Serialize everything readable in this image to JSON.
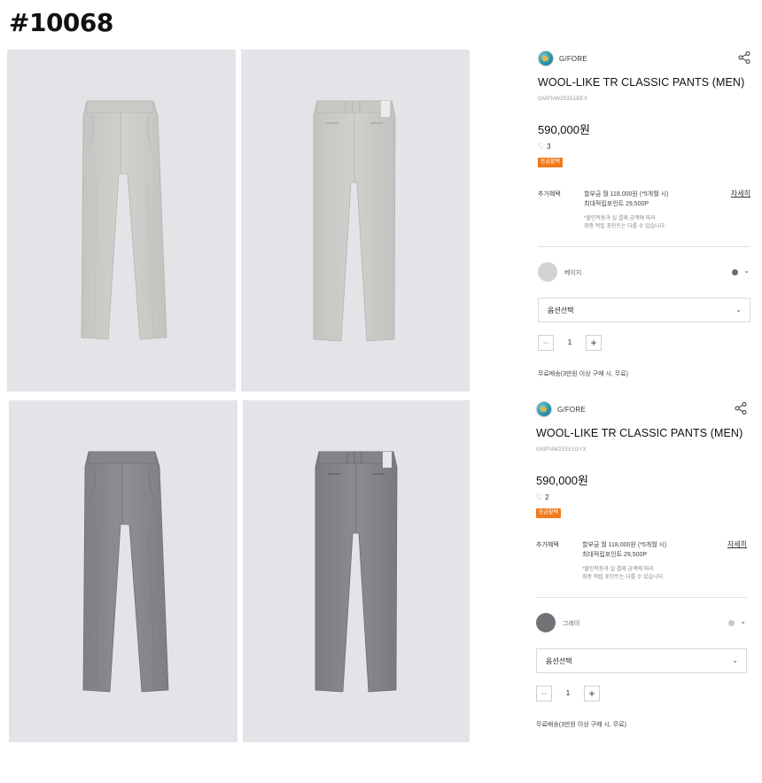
{
  "page_id": "#10068",
  "products": [
    {
      "brand": "G/FORE",
      "title": "WOOL-LIKE TR CLASSIC PANTS (MEN)",
      "code": "GMPNW25351BEX",
      "price": "590,000원",
      "likes": "3",
      "badge": "등급할택",
      "benefit_label": "추가혜택",
      "benefit_line1": "할부금 월 118,000원 (*5개월 시)",
      "benefit_line2": "최대적립포인트 29,500P",
      "benefit_note1": "*할인적용과 실 결제 금액에 따라",
      "benefit_note2": "최종 적립 포인트는 다를 수 있습니다.",
      "detail_link": "자세히",
      "color_name": "베이지",
      "swatch_color": "#d4d3d1",
      "dot_color": "#6b6b6b",
      "option_label": "옵션선택",
      "qty_minus": "−",
      "qty": "1",
      "qty_plus": "+",
      "shipping": "무료배송(3만원 이상 구매 시, 무료)"
    },
    {
      "brand": "G/FORE",
      "title": "WOOL-LIKE TR CLASSIC PANTS (MEN)",
      "code": "GMPNW25351GYX",
      "price": "590,000원",
      "likes": "2",
      "badge": "등급할택",
      "benefit_label": "추가혜택",
      "benefit_line1": "할부금 월 118,000원 (*5개월 시)",
      "benefit_line2": "최대적립포인트 29,500P",
      "benefit_note1": "*할인적용과 실 결제 금액에 따라",
      "benefit_note2": "최종 적립 포인트는 다를 수 있습니다.",
      "detail_link": "자세히",
      "color_name": "그레이",
      "swatch_color": "#727276",
      "dot_color": "#c8c8c8",
      "option_label": "옵션선택",
      "qty_minus": "−",
      "qty": "1",
      "qty_plus": "+",
      "shipping": "무료배송(3만원 이상 구매 시, 무료)"
    }
  ],
  "colors": {
    "photo_bg": "#e3e3e8",
    "pants_beige": "#cfcdc9",
    "pants_gray": "#8a8b8f",
    "badge": "#f27a1a"
  }
}
